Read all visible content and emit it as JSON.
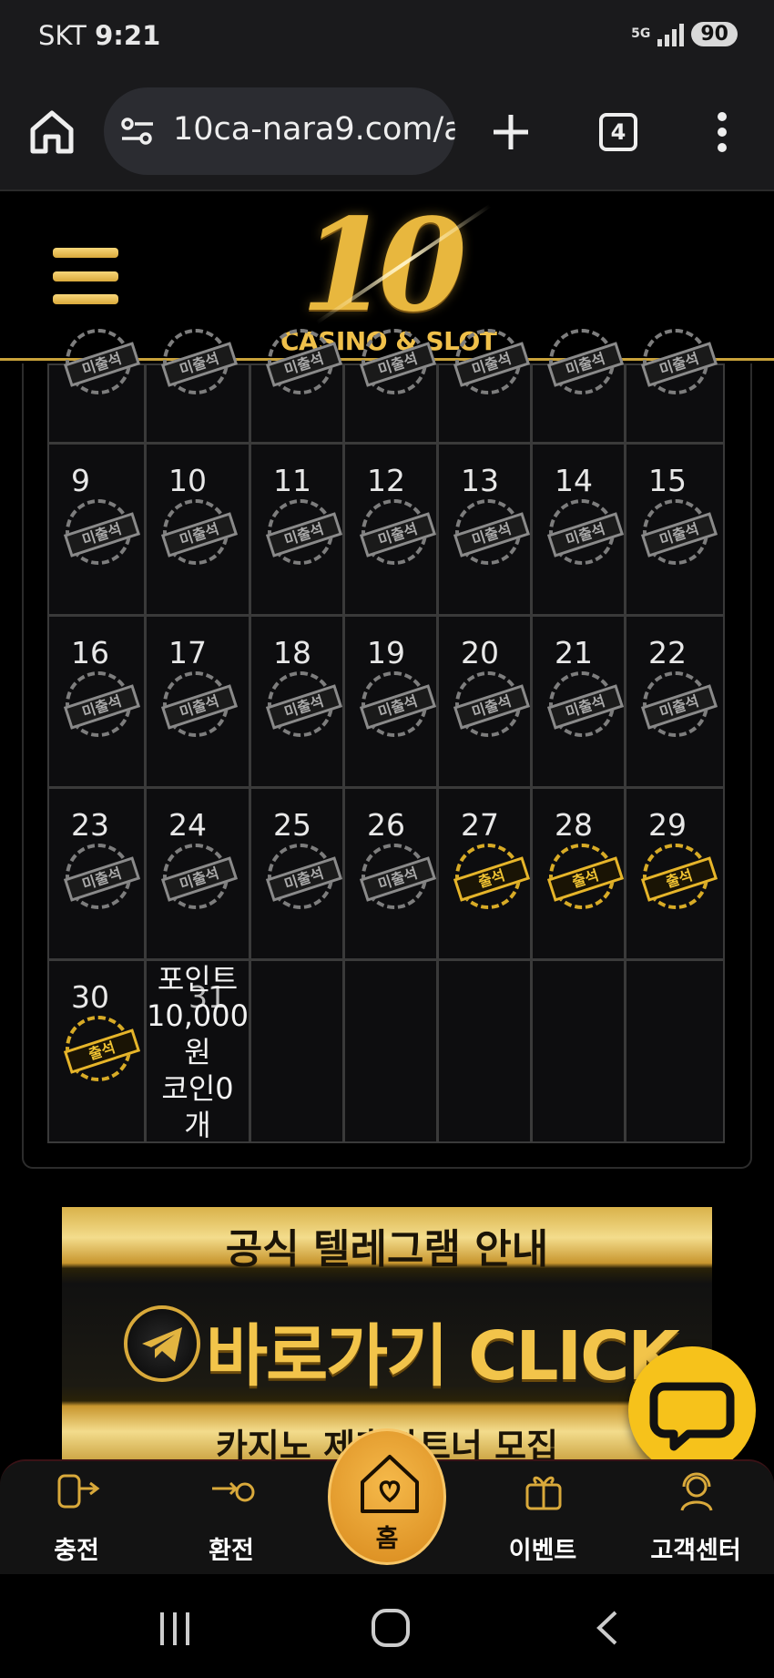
{
  "status_bar": {
    "carrier": "SKT",
    "time": "9:21",
    "network": "5G",
    "battery": "90"
  },
  "browser": {
    "url": "10ca-nara9.com/a",
    "tab_count": "4"
  },
  "site": {
    "logo_number": "10",
    "logo_subtitle": "CASINO & SLOT"
  },
  "calendar": {
    "stamp_absent": "미출석",
    "stamp_present": "출석",
    "top_partial_row_count": 7,
    "rows": [
      [
        {
          "day": "9",
          "status": "absent"
        },
        {
          "day": "10",
          "status": "absent"
        },
        {
          "day": "11",
          "status": "absent"
        },
        {
          "day": "12",
          "status": "absent"
        },
        {
          "day": "13",
          "status": "absent"
        },
        {
          "day": "14",
          "status": "absent"
        },
        {
          "day": "15",
          "status": "absent"
        }
      ],
      [
        {
          "day": "16",
          "status": "absent"
        },
        {
          "day": "17",
          "status": "absent"
        },
        {
          "day": "18",
          "status": "absent"
        },
        {
          "day": "19",
          "status": "absent"
        },
        {
          "day": "20",
          "status": "absent"
        },
        {
          "day": "21",
          "status": "absent"
        },
        {
          "day": "22",
          "status": "absent"
        }
      ],
      [
        {
          "day": "23",
          "status": "absent"
        },
        {
          "day": "24",
          "status": "absent"
        },
        {
          "day": "25",
          "status": "absent"
        },
        {
          "day": "26",
          "status": "absent"
        },
        {
          "day": "27",
          "status": "present"
        },
        {
          "day": "28",
          "status": "present"
        },
        {
          "day": "29",
          "status": "present"
        }
      ]
    ],
    "last_row_day": "30",
    "last_row_status": "present",
    "overlap_day": "31",
    "summary_lines": [
      "포인트",
      "10,000",
      "원",
      "코인0",
      "개"
    ]
  },
  "banner": {
    "title": "공식 텔레그램 안내",
    "cta": "바로가기 CLICK",
    "bottom": "카지노 제휴파트너 모집"
  },
  "bottom_nav": {
    "charge": "충전",
    "exchange": "환전",
    "home": "홈",
    "event": "이벤트",
    "support": "고객센터"
  }
}
